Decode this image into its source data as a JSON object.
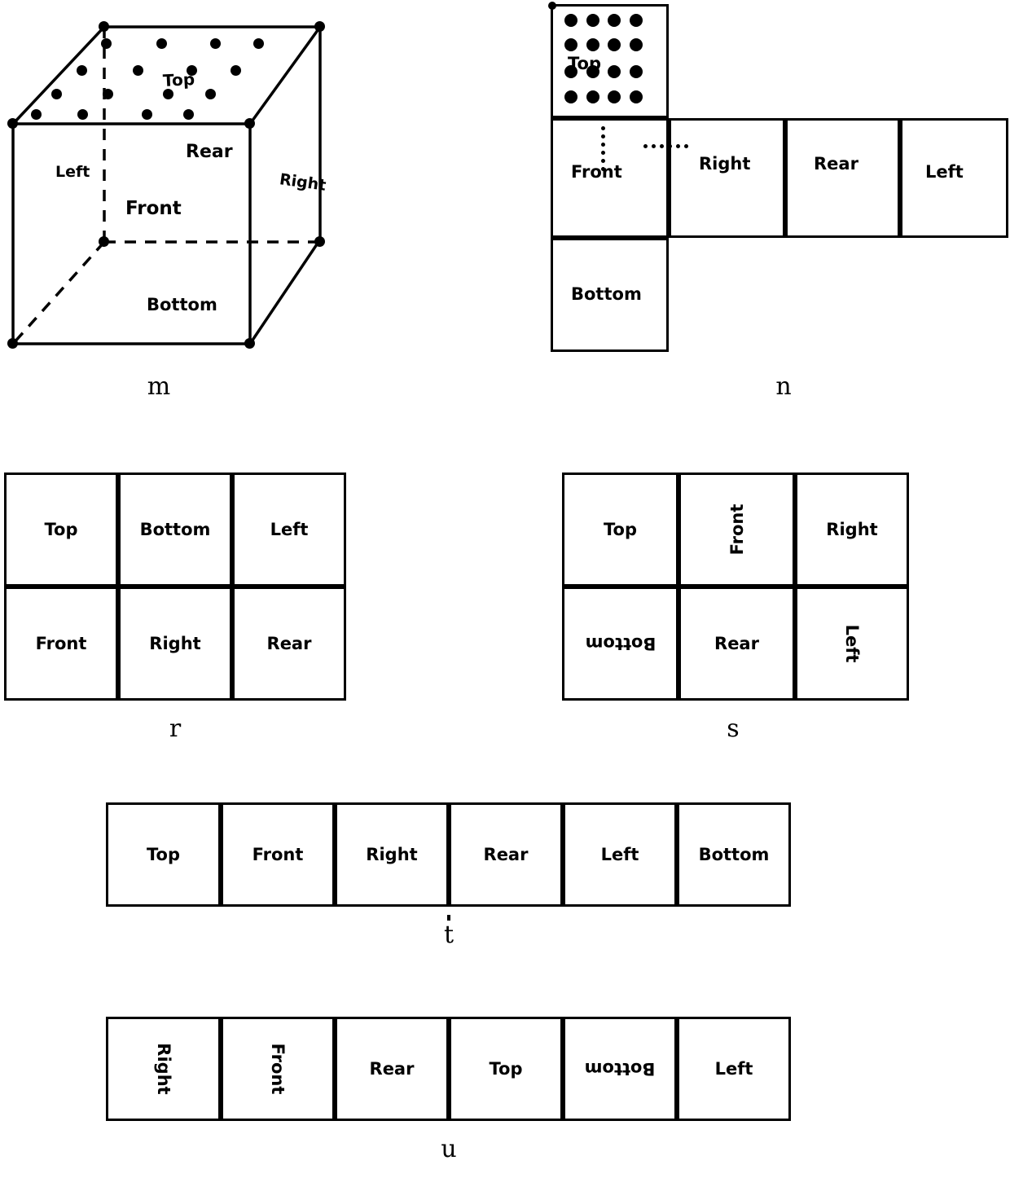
{
  "figures": [
    {
      "id": "m",
      "caption": "m",
      "type": "cube-3d",
      "faces": [
        {
          "name": "Top",
          "label": "Top"
        },
        {
          "name": "Rear",
          "label": "Rear"
        },
        {
          "name": "Left",
          "label": "Left"
        },
        {
          "name": "Front",
          "label": "Front"
        },
        {
          "name": "Right",
          "label": "Right"
        },
        {
          "name": "Bottom",
          "label": "Bottom"
        }
      ],
      "dot_grid": {
        "rows": 4,
        "cols": 4,
        "on_face": "Top"
      }
    },
    {
      "id": "n",
      "caption": "n",
      "type": "cross-net",
      "cells": [
        {
          "label": "Top",
          "row": 0,
          "col": 0,
          "rotation": 0,
          "dots": true
        },
        {
          "label": "Front",
          "row": 1,
          "col": 0,
          "rotation": 0
        },
        {
          "label": "Right",
          "row": 1,
          "col": 1,
          "rotation": 0
        },
        {
          "label": "Rear",
          "row": 1,
          "col": 2,
          "rotation": 0
        },
        {
          "label": "Left",
          "row": 1,
          "col": 3,
          "rotation": 0
        },
        {
          "label": "Bottom",
          "row": 2,
          "col": 0,
          "rotation": 0
        }
      ],
      "dot_grid": {
        "rows": 4,
        "cols": 4,
        "on_face": "Top"
      }
    },
    {
      "id": "r",
      "caption": "r",
      "type": "grid-2x3",
      "cells": [
        {
          "label": "Top",
          "row": 0,
          "col": 0,
          "rotation": 0
        },
        {
          "label": "Bottom",
          "row": 0,
          "col": 1,
          "rotation": 0
        },
        {
          "label": "Left",
          "row": 0,
          "col": 2,
          "rotation": 0
        },
        {
          "label": "Front",
          "row": 1,
          "col": 0,
          "rotation": 0
        },
        {
          "label": "Right",
          "row": 1,
          "col": 1,
          "rotation": 0
        },
        {
          "label": "Rear",
          "row": 1,
          "col": 2,
          "rotation": 0
        }
      ]
    },
    {
      "id": "s",
      "caption": "s",
      "type": "grid-2x3",
      "cells": [
        {
          "label": "Top",
          "row": 0,
          "col": 0,
          "rotation": 0
        },
        {
          "label": "Front",
          "row": 0,
          "col": 1,
          "rotation": -90
        },
        {
          "label": "Right",
          "row": 0,
          "col": 2,
          "rotation": 0
        },
        {
          "label": "Bottom",
          "row": 1,
          "col": 0,
          "rotation": 180
        },
        {
          "label": "Rear",
          "row": 1,
          "col": 1,
          "rotation": 0
        },
        {
          "label": "Left",
          "row": 1,
          "col": 2,
          "rotation": 90
        }
      ]
    },
    {
      "id": "t",
      "caption": "t",
      "type": "strip-1x6",
      "cells": [
        {
          "label": "Top",
          "col": 0,
          "rotation": 0
        },
        {
          "label": "Front",
          "col": 1,
          "rotation": 0
        },
        {
          "label": "Right",
          "col": 2,
          "rotation": 0
        },
        {
          "label": "Rear",
          "col": 3,
          "rotation": 0
        },
        {
          "label": "Left",
          "col": 4,
          "rotation": 0
        },
        {
          "label": "Bottom",
          "col": 5,
          "rotation": 0
        }
      ]
    },
    {
      "id": "u",
      "caption": "u",
      "type": "strip-1x6",
      "cells": [
        {
          "label": "Right",
          "col": 0,
          "rotation": 90
        },
        {
          "label": "Front",
          "col": 1,
          "rotation": 90
        },
        {
          "label": "Rear",
          "col": 2,
          "rotation": 0
        },
        {
          "label": "Top",
          "col": 3,
          "rotation": 0
        },
        {
          "label": "Bottom",
          "col": 4,
          "rotation": 180
        },
        {
          "label": "Left",
          "col": 5,
          "rotation": 0
        }
      ]
    }
  ]
}
